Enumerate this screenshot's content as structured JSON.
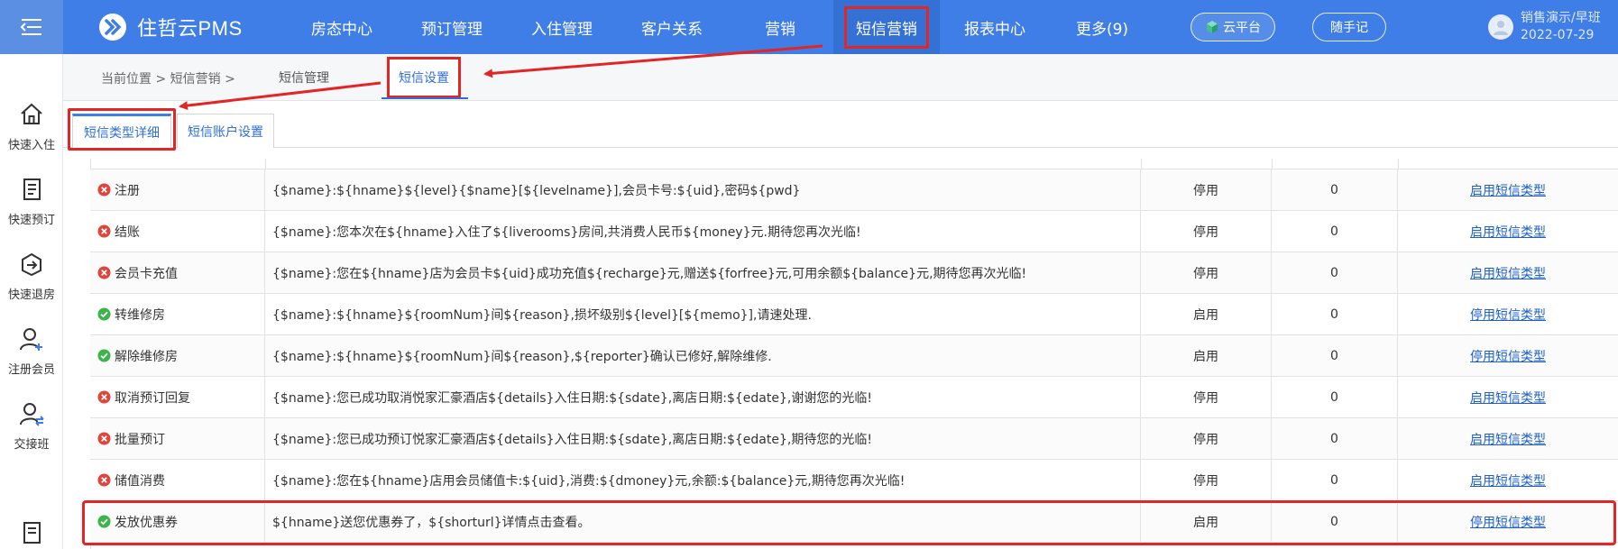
{
  "header": {
    "logo_text": "住哲云PMS",
    "nav": [
      {
        "label": "房态中心"
      },
      {
        "label": "预订管理"
      },
      {
        "label": "入住管理"
      },
      {
        "label": "客户关系"
      },
      {
        "label": "营销"
      },
      {
        "label": "短信营销",
        "active": true
      },
      {
        "label": "报表中心"
      },
      {
        "label": "更多(9)"
      }
    ],
    "cloud_label": "云平台",
    "notes_label": "随手记",
    "user_name": "销售演示/早班",
    "user_date": "2022-07-29"
  },
  "sidebar": {
    "items": [
      {
        "label": "快速入住",
        "icon": "home-icon"
      },
      {
        "label": "快速预订",
        "icon": "booking-icon"
      },
      {
        "label": "快速退房",
        "icon": "checkout-icon"
      },
      {
        "label": "注册会员",
        "icon": "add-user-icon"
      },
      {
        "label": "交接班",
        "icon": "shift-handover-icon"
      }
    ]
  },
  "breadcrumb": {
    "prefix": "当前位置 > 短信营销 >",
    "tabs": [
      {
        "label": "短信管理"
      },
      {
        "label": "短信设置",
        "active": true
      }
    ]
  },
  "inner_tabs": [
    {
      "label": "短信类型详细",
      "active": true
    },
    {
      "label": "短信账户设置"
    }
  ],
  "table": {
    "rows": [
      {
        "name": "注册",
        "state": "disabled",
        "template": "{$name}:${hname}${level}{$name}[${levelname}],会员卡号:${uid},密码${pwd}",
        "status": "停用",
        "count": "0",
        "action": "启用短信类型"
      },
      {
        "name": "结账",
        "state": "disabled",
        "template": "{$name}:您本次在${hname}入住了${liverooms}房间,共消费人民币${money}元.期待您再次光临!",
        "status": "停用",
        "count": "0",
        "action": "启用短信类型"
      },
      {
        "name": "会员卡充值",
        "state": "disabled",
        "template": "{$name}:您在${hname}店为会员卡${uid}成功充值${recharge}元,赠送${forfree}元,可用余额${balance}元,期待您再次光临!",
        "status": "停用",
        "count": "0",
        "action": "启用短信类型"
      },
      {
        "name": "转维修房",
        "state": "enabled",
        "template": "{$name}:${hname}${roomNum}间${reason},损坏级别${level}[${memo}],请速处理.",
        "status": "启用",
        "count": "0",
        "action": "停用短信类型"
      },
      {
        "name": "解除维修房",
        "state": "enabled",
        "template": "{$name}:${hname}${roomNum}间${reason},${reporter}确认已修好,解除维修.",
        "status": "启用",
        "count": "0",
        "action": "停用短信类型"
      },
      {
        "name": "取消预订回复",
        "state": "disabled",
        "template": "{$name}:您已成功取消悦家汇豪酒店${details}入住日期:${sdate},离店日期:${edate},谢谢您的光临!",
        "status": "停用",
        "count": "0",
        "action": "启用短信类型"
      },
      {
        "name": "批量预订",
        "state": "disabled",
        "template": "{$name}:您已成功预订悦家汇豪酒店${details}入住日期:${sdate},离店日期:${edate},期待您的光临!",
        "status": "停用",
        "count": "0",
        "action": "启用短信类型"
      },
      {
        "name": "储值消费",
        "state": "disabled",
        "template": "{$name}:您在${hname}店用会员储值卡:${uid},消费:${dmoney}元,余额:${balance}元,期待您再次光临!",
        "status": "停用",
        "count": "0",
        "action": "启用短信类型"
      },
      {
        "name": "发放优惠券",
        "state": "enabled",
        "template": "${hname}送您优惠券了，${shorturl}详情点击查看。",
        "status": "启用",
        "count": "0",
        "action": "停用短信类型"
      }
    ]
  },
  "colors": {
    "header_bg": "#3f7ee6",
    "active_nav_bg": "#3570d4",
    "annotation_red": "#e22626",
    "link_blue": "#1d5fc8",
    "enabled_green": "#3bb54a",
    "disabled_red": "#e0443b"
  }
}
